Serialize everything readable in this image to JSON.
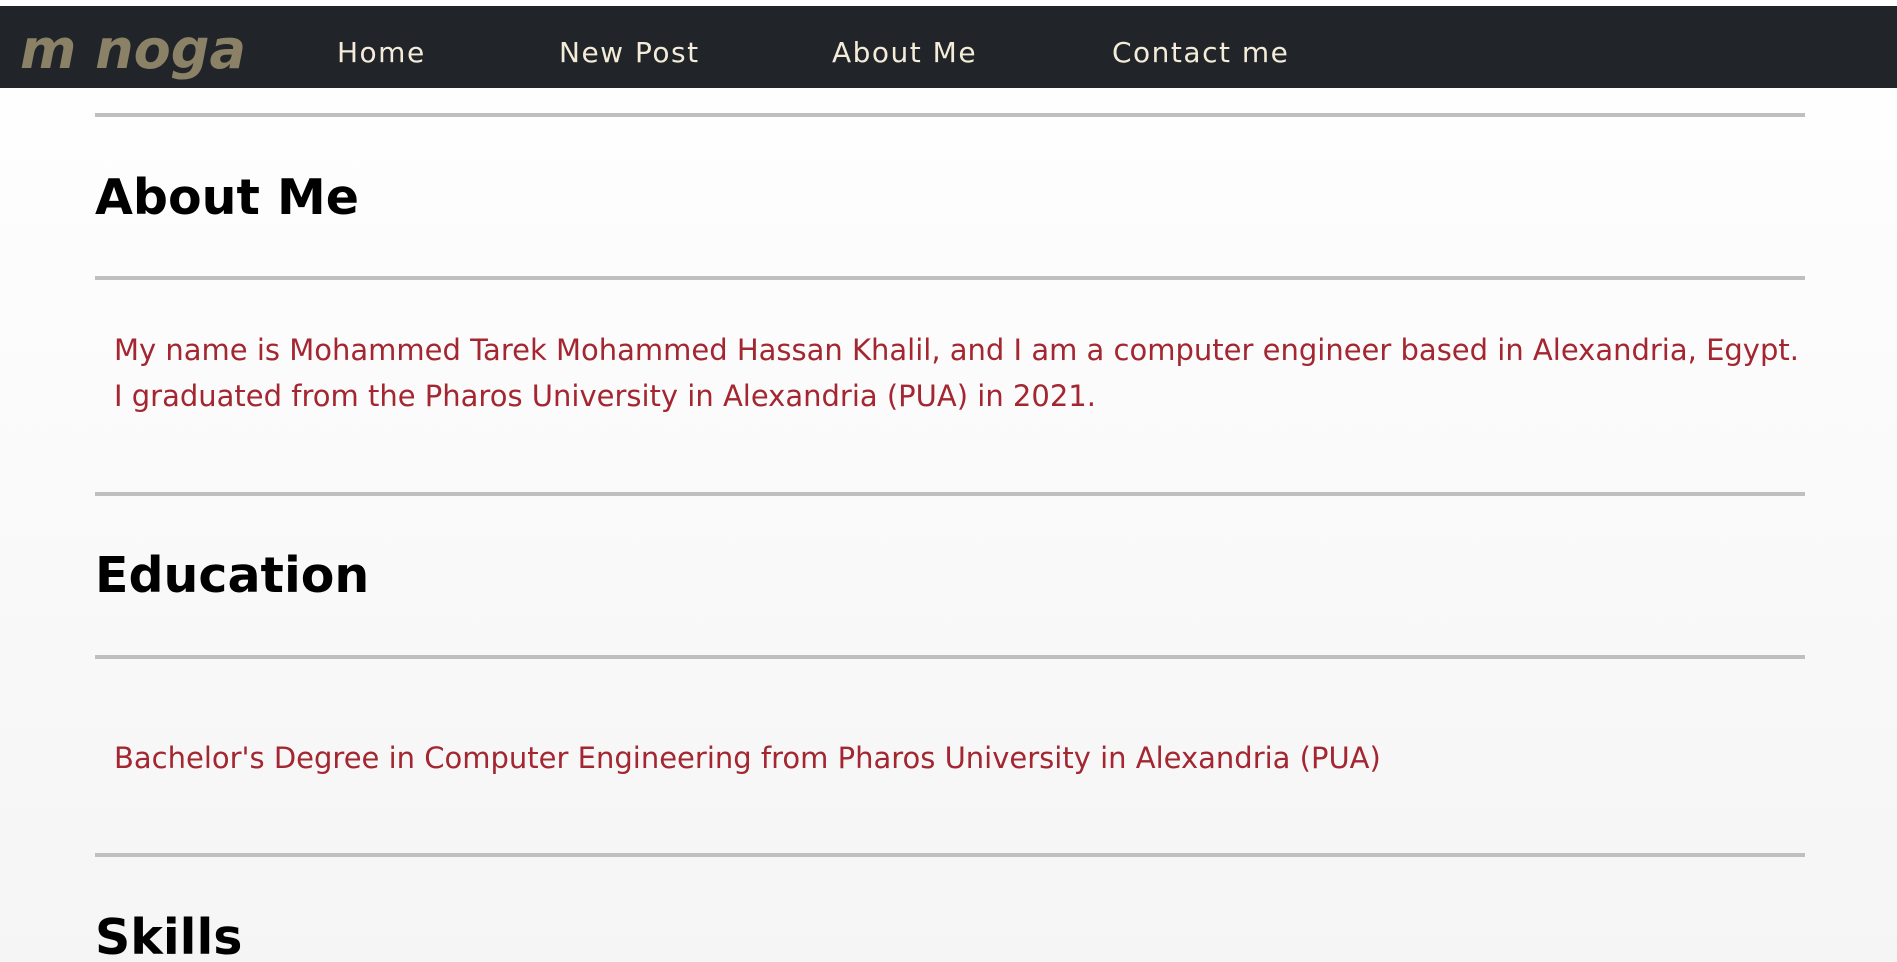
{
  "brand": {
    "logo_text": "m noga",
    "logo_color": "#8a8167"
  },
  "nav": {
    "items": [
      {
        "label": "Home"
      },
      {
        "label": "New Post"
      },
      {
        "label": "About Me"
      },
      {
        "label": "Contact me"
      }
    ]
  },
  "sections": {
    "about": {
      "title": "About Me",
      "line1": "My name is Mohammed Tarek Mohammed Hassan Khalil, and I am a computer engineer based in Alexandria, Egypt.",
      "line2": "I graduated from the Pharos University in Alexandria (PUA) in 2021."
    },
    "education": {
      "title": "Education",
      "text": "Bachelor's Degree in Computer Engineering from Pharos University in Alexandria (PUA)"
    },
    "skills": {
      "title": "Skills"
    }
  },
  "colors": {
    "navbar_bg": "#212529",
    "nav_text": "#f4ecd8",
    "body_text": "#a32630",
    "divider": "#bfbfc1"
  }
}
